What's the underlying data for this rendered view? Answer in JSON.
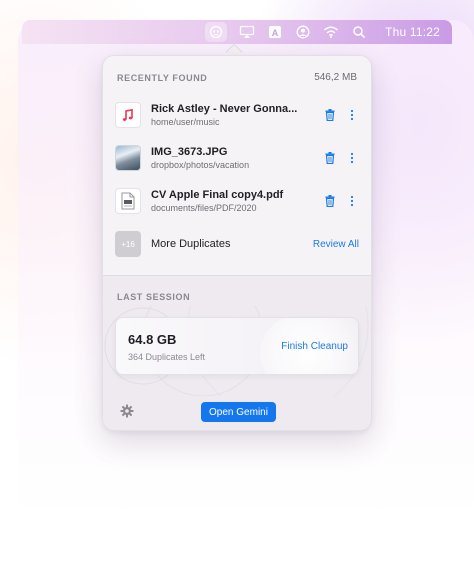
{
  "menubar": {
    "clock": "Thu 11:22",
    "input_source": "A",
    "icons": [
      "gemini-icon",
      "airplay-icon",
      "input-source-icon",
      "user-icon",
      "wifi-icon",
      "search-icon"
    ]
  },
  "recently_found": {
    "heading": "RECENTLY FOUND",
    "total_size": "546,2 MB",
    "items": [
      {
        "title": "Rick Astley - Never Gonna...",
        "path": "home/user/music",
        "icon": "music-file-icon"
      },
      {
        "title": "IMG_3673.JPG",
        "path": "dropbox/photos/vacation",
        "icon": "photo-thumbnail"
      },
      {
        "title": "CV Apple Final copy4.pdf",
        "path": "documents/files/PDF/2020",
        "icon": "pdf-file-icon"
      }
    ],
    "more": {
      "badge": "+16",
      "label": "More Duplicates",
      "link": "Review All"
    }
  },
  "last_session": {
    "heading": "LAST SESSION",
    "size": "64.8 GB",
    "subtitle": "364 Duplicates Left",
    "action": "Finish Cleanup"
  },
  "footer": {
    "open_button": "Open Gemini"
  },
  "colors": {
    "accent": "#1477ee",
    "link": "#1a7be8",
    "trash": "#1a7be8"
  }
}
